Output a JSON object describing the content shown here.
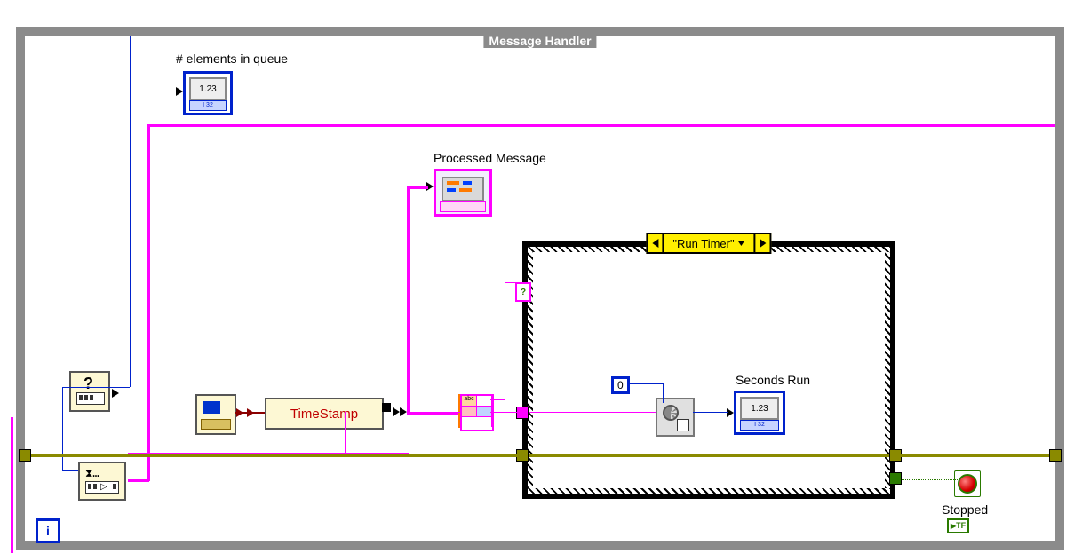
{
  "loop": {
    "title": "Message Handler"
  },
  "labels": {
    "elements_in_queue": "# elements in queue",
    "processed_message": "Processed Message",
    "seconds_run": "Seconds Run",
    "stopped": "Stopped",
    "timestamp": "TimeStamp"
  },
  "case": {
    "selector_value": "\"Run Timer\""
  },
  "indicators": {
    "numeric_display": "1.23",
    "i32_tag": "I 32",
    "tf_tag": "TF",
    "zero_constant": "0",
    "iteration_terminal": "i"
  },
  "nodes": {
    "help": "?",
    "unbundle_top": "abc"
  }
}
